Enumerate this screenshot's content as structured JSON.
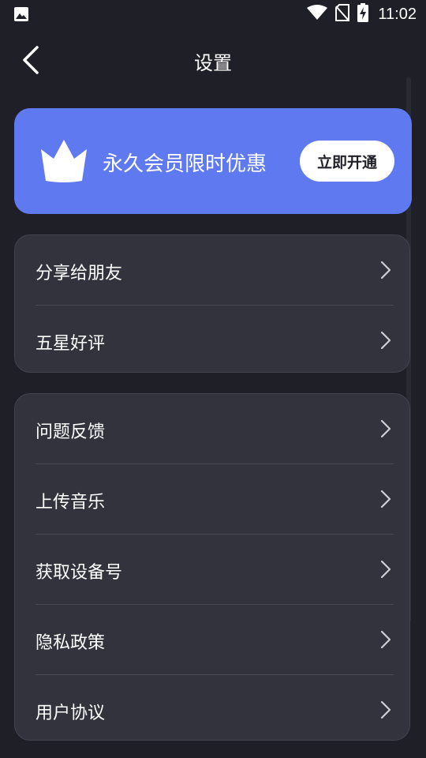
{
  "status_bar": {
    "time": "11:02",
    "icons": [
      "image-icon",
      "wifi-icon",
      "no-sim-icon",
      "battery-charging-icon"
    ]
  },
  "header": {
    "title": "设置",
    "back_icon": "chevron-left-icon"
  },
  "vip": {
    "text": "永久会员限时优惠",
    "button_label": "立即开通",
    "icon": "crown-icon",
    "color": "#5f79f0"
  },
  "group1": [
    {
      "label": "分享给朋友"
    },
    {
      "label": "五星好评"
    }
  ],
  "group2": [
    {
      "label": "问题反馈"
    },
    {
      "label": "上传音乐"
    },
    {
      "label": "获取设备号"
    },
    {
      "label": "隐私政策"
    },
    {
      "label": "用户协议"
    }
  ],
  "colors": {
    "background": "#1f1f27",
    "card": "#33333d",
    "accent": "#5f79f0"
  }
}
